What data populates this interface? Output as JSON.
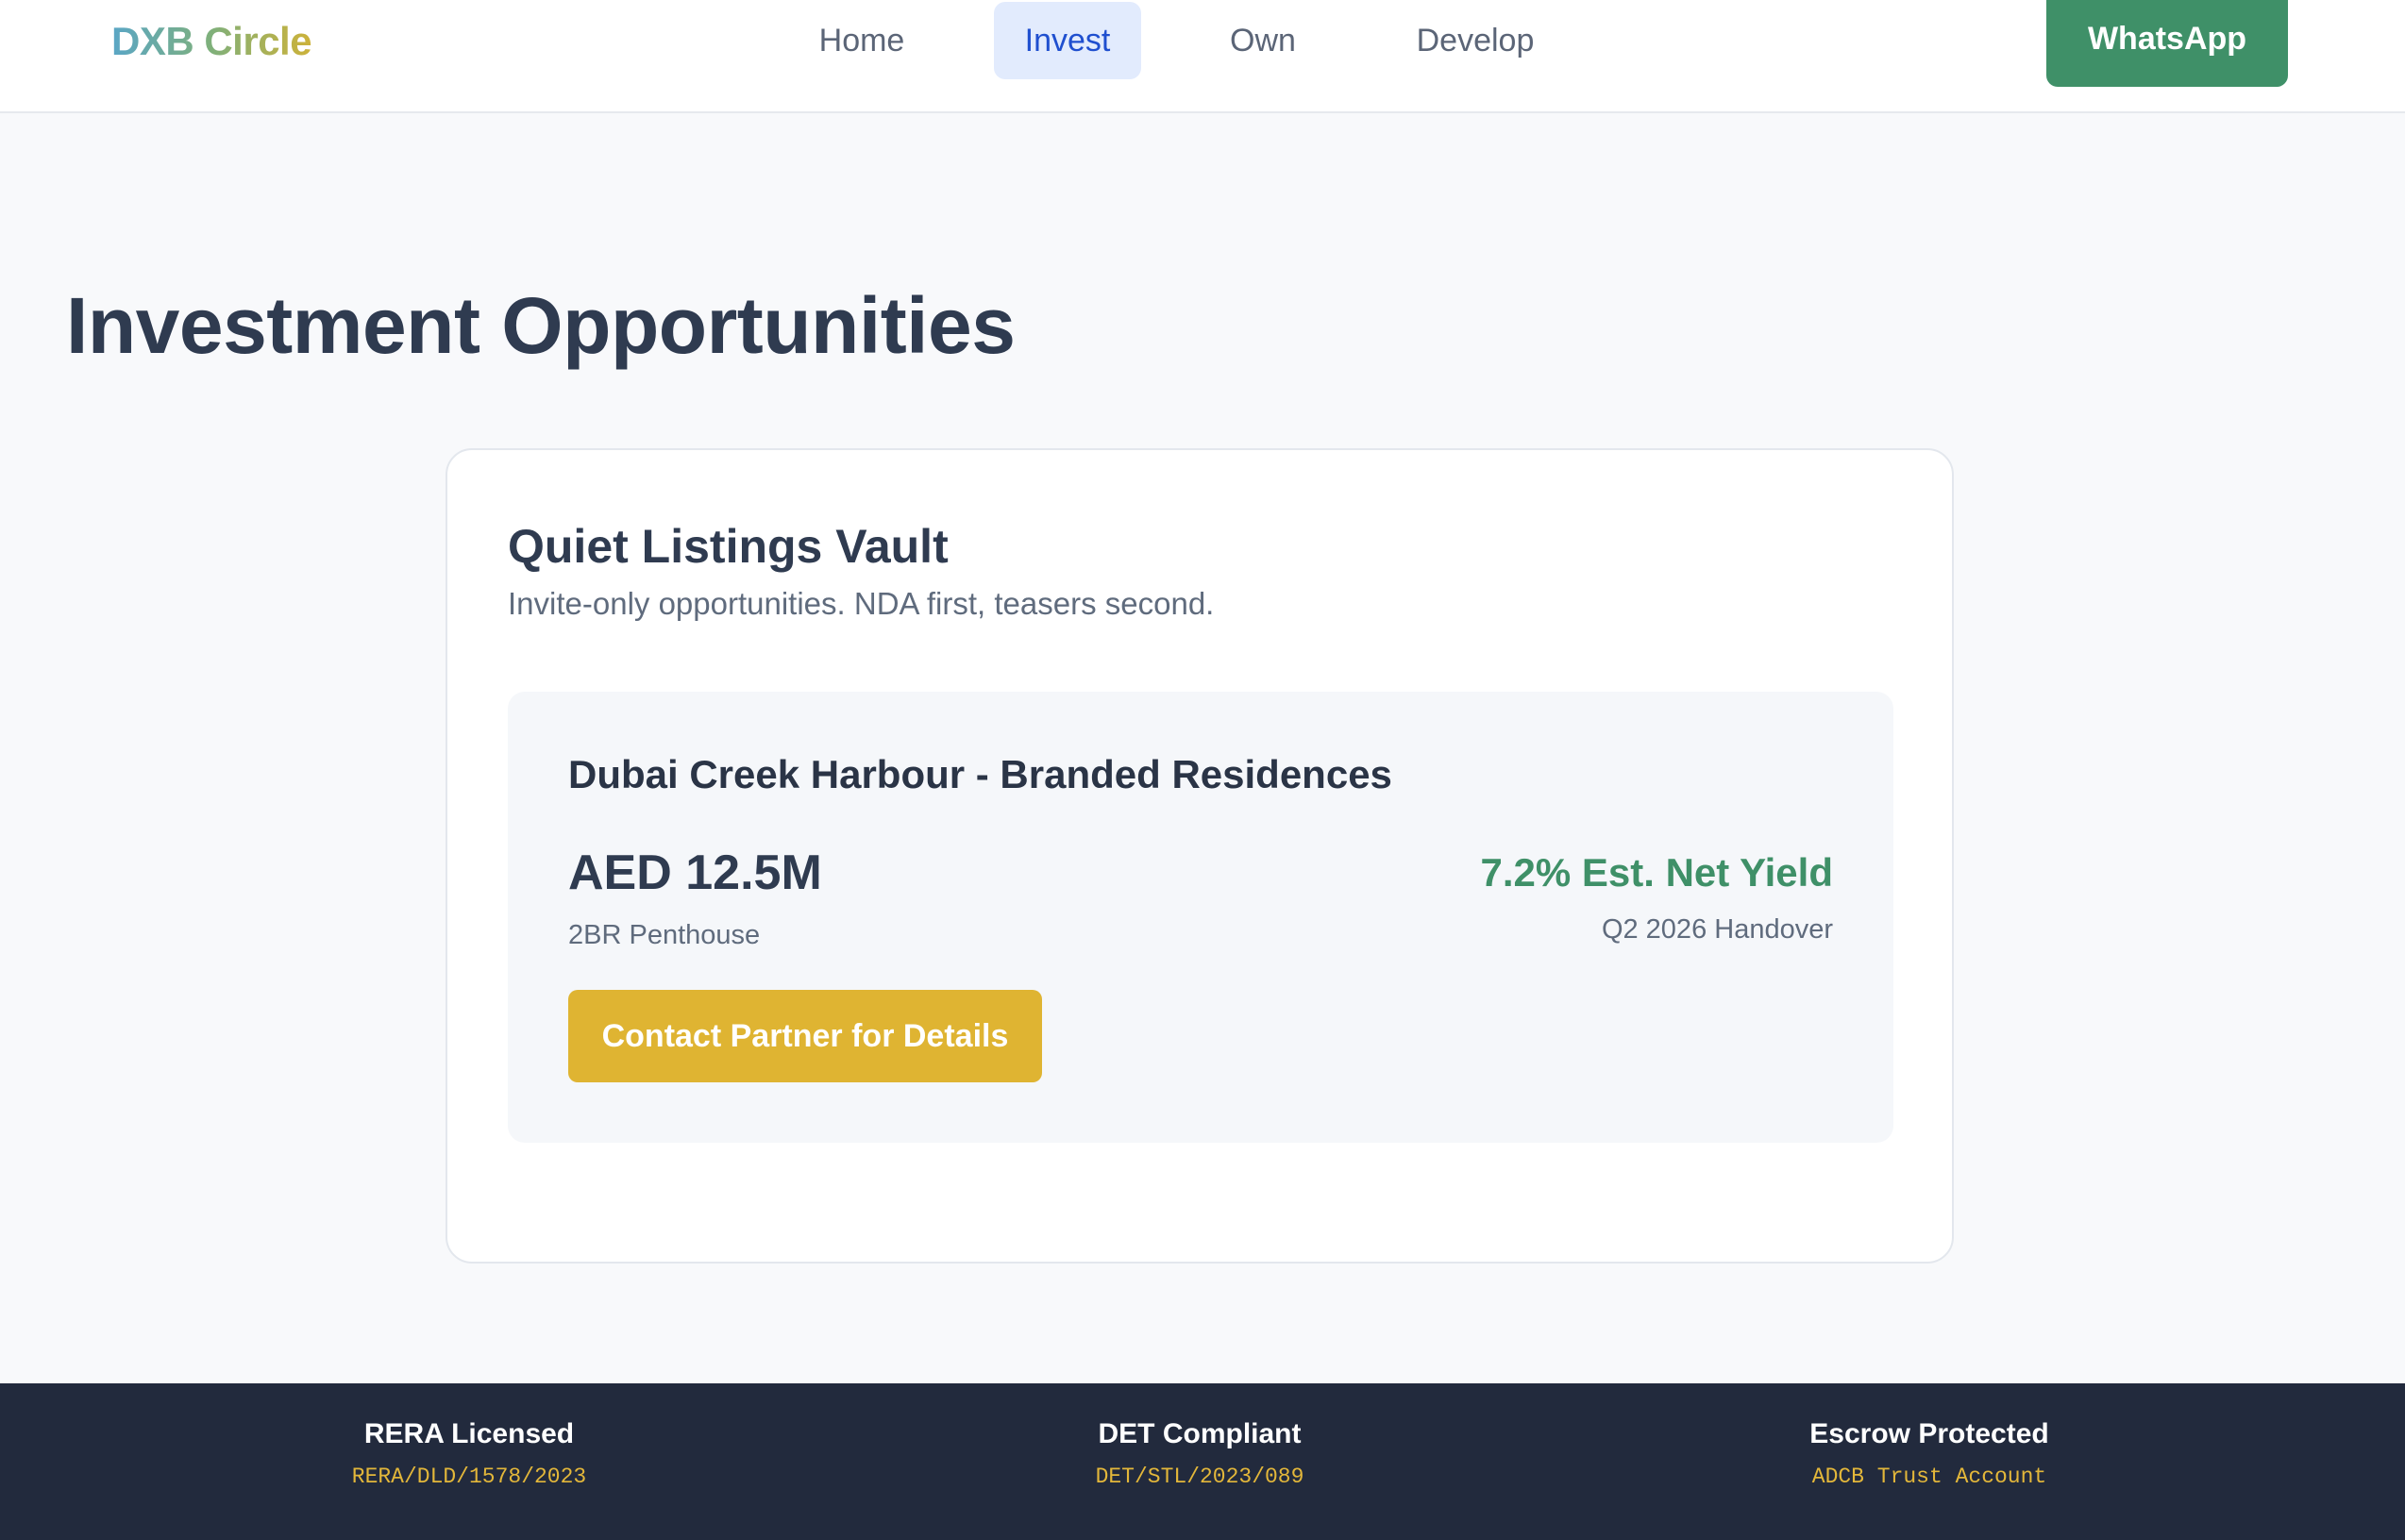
{
  "header": {
    "logo": "DXB Circle",
    "nav": [
      {
        "label": "Home",
        "active": false
      },
      {
        "label": "Invest",
        "active": true
      },
      {
        "label": "Own",
        "active": false
      },
      {
        "label": "Develop",
        "active": false
      }
    ],
    "cta_label": "WhatsApp"
  },
  "main": {
    "title": "Investment Opportunities",
    "vault": {
      "title": "Quiet Listings Vault",
      "subtitle": "Invite-only opportunities. NDA first, teasers second.",
      "listing": {
        "title": "Dubai Creek Harbour - Branded Residences",
        "price": "AED 12.5M",
        "unit_type": "2BR Penthouse",
        "yield": "7.2% Est. Net Yield",
        "handover": "Q2 2026 Handover",
        "cta_label": "Contact Partner for Details"
      }
    }
  },
  "footer": {
    "badges": [
      {
        "title": "RERA Licensed",
        "code": "RERA/DLD/1578/2023"
      },
      {
        "title": "DET Compliant",
        "code": "DET/STL/2023/089"
      },
      {
        "title": "Escrow Protected",
        "code": "ADCB Trust Account"
      }
    ]
  },
  "colors": {
    "brand_gradient": [
      "#5aa6c6",
      "#7fb07a",
      "#cdb23a"
    ],
    "whatsapp_green": "#3f9068",
    "accent_gold": "#dfb432",
    "nav_active_bg": "#e2ebfd",
    "nav_active_text": "#1f4fcf",
    "footer_bg": "#222a3d"
  }
}
